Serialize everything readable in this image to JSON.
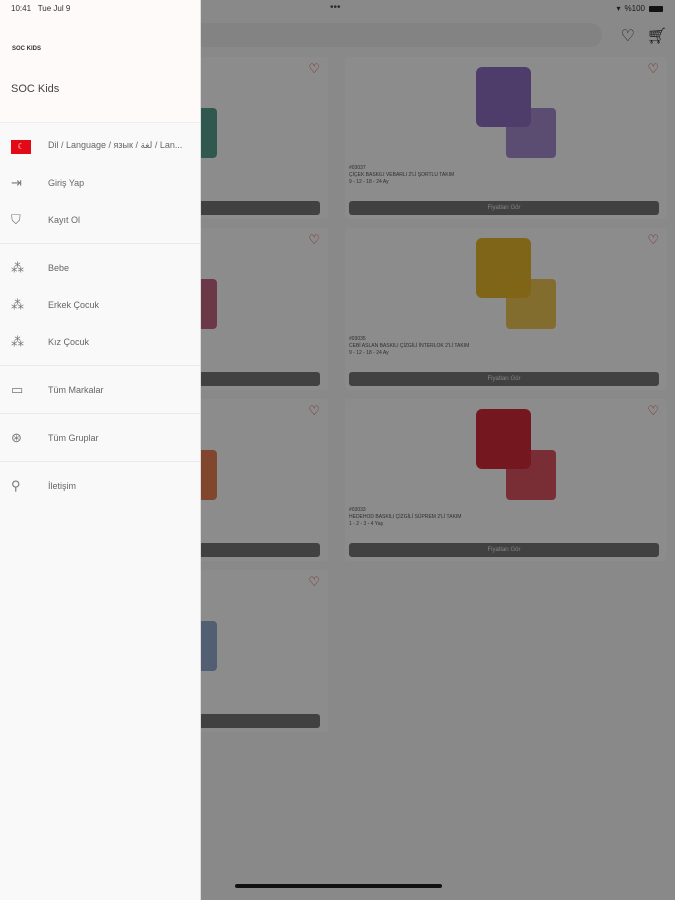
{
  "status": {
    "time": "10:41",
    "date": "Tue Jul 9",
    "battery": "%100"
  },
  "drawer": {
    "logo": "SOC KIDS",
    "brand": "SOC Kids",
    "items": [
      {
        "label": "Dil / Language / язык / لغة / Lan...",
        "icon": "turkey-flag-icon"
      },
      {
        "label": "Giriş Yap",
        "icon": "login-icon"
      },
      {
        "label": "Kayıt Ol",
        "icon": "shield-check-icon"
      },
      {
        "label": "Bebe",
        "icon": "category-icon"
      },
      {
        "label": "Erkek Çocuk",
        "icon": "category-icon"
      },
      {
        "label": "Kız Çocuk",
        "icon": "category-icon"
      },
      {
        "label": "Tüm Markalar",
        "icon": "brands-icon"
      },
      {
        "label": "Tüm Gruplar",
        "icon": "groups-icon"
      },
      {
        "label": "İletişim",
        "icon": "location-icon"
      }
    ]
  },
  "products": [
    {
      "code": "",
      "name": "",
      "sizes": "",
      "button": "Fiyatları Gör",
      "color": "#2f8a76"
    },
    {
      "code": "#03037",
      "name": "ÇİÇEK BASKILI VEBARLI 2'Lİ ŞORTLU TAKIM",
      "sizes": "9 - 12 - 18 - 24 Ay",
      "button": "Fiyatları Gör",
      "color": "#8e6fc2"
    },
    {
      "code": "",
      "name": "",
      "sizes": "",
      "button": "Fiyatları Gör",
      "color": "#b24060"
    },
    {
      "code": "#03035",
      "name": "CEBİ ASLAN BASKILI ÇİZGİLİ İNTERLOK 2'Lİ TAKIM",
      "sizes": "9 - 12 - 18 - 24 Ay",
      "button": "Fiyatları Gör",
      "color": "#e8b92a"
    },
    {
      "code": "",
      "name": "",
      "sizes": "",
      "button": "Fiyatları Gör",
      "color": "#e3622a"
    },
    {
      "code": "#03033",
      "name": "HEDEHOD BASKILI ÇİZGİLİ SÜPREM 2'Lİ TAKIM",
      "sizes": "1 - 2 - 3 - 4 Yaş",
      "button": "Fiyatları Gör",
      "color": "#d42b3a"
    },
    {
      "code": "",
      "name": "",
      "sizes": "",
      "button": "Fiyatları Gör",
      "color": "#7a9ac4"
    }
  ]
}
